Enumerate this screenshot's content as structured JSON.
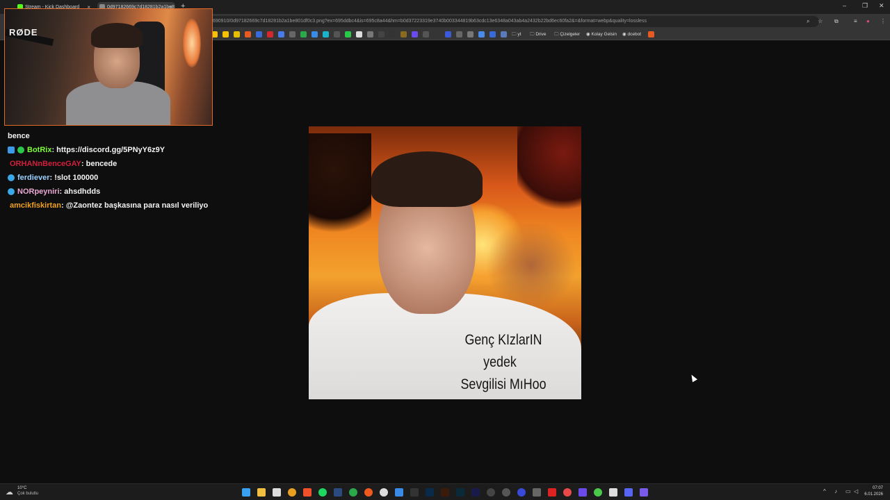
{
  "browser": {
    "tabs": [
      {
        "title": "Stream - Kick Dashboard",
        "icon_color": "#53fc18"
      },
      {
        "title": "0d97182669c7d18281b2a1be8",
        "icon_color": "#888888"
      }
    ],
    "new_tab_label": "+",
    "close_label": "×",
    "window_controls": {
      "minimize": "–",
      "maximize": "❐",
      "close": "✕"
    },
    "url": "690910/0d97182669c7d18281b2a1be801df0c3.png?ex=695ddbc4&is=695c8a44&hm=b0d37223319e3740b003344819b63cdc13e6348a043ab4a2432b22bd6ec60fa2&=&format=webp&quality=lossless",
    "bookmarks": [
      {
        "label": "yt"
      },
      {
        "label": "Drive"
      },
      {
        "label": "Çizelgeler"
      },
      {
        "label": "Kolay Gelsin"
      },
      {
        "label": "dcebot"
      }
    ]
  },
  "webcam": {
    "mic_brand": "RØDE"
  },
  "chat": {
    "messages": [
      {
        "user": "",
        "text": "bence",
        "user_color": "#f3f3f3",
        "badges": []
      },
      {
        "user": "BotRix",
        "text": " : https://discord.gg/5PNyY6z9Y",
        "user_color": "#7cfc3a",
        "badges": [
          "bot-badge",
          "verified-badge"
        ]
      },
      {
        "user": "ORHANnBenceGAY",
        "text": " : bencede",
        "user_color": "#d21f3c",
        "badges": []
      },
      {
        "user": "ferdiever",
        "text": " : !slot 100000",
        "user_color": "#9ad0ff",
        "badges": [
          "subscriber-badge"
        ]
      },
      {
        "user": "NORpeyniri",
        "text": " : ahsdhdds",
        "user_color": "#e9a9d4",
        "badges": [
          "subscriber-badge"
        ]
      },
      {
        "user": "amcikfiskirtan",
        "text": " : @Zaontez başkasına para nasıl veriliyo",
        "user_color": "#f0a020",
        "badges": []
      }
    ]
  },
  "meme_image": {
    "caption_lines": [
      "Genç KIzlarIN",
      "yedek",
      "Sevgilisi MıHoo"
    ]
  },
  "taskbar": {
    "weather_temp": "10°C",
    "weather_desc": "Çok bulutlu",
    "time": "07:07",
    "date": "6.01.2026"
  }
}
